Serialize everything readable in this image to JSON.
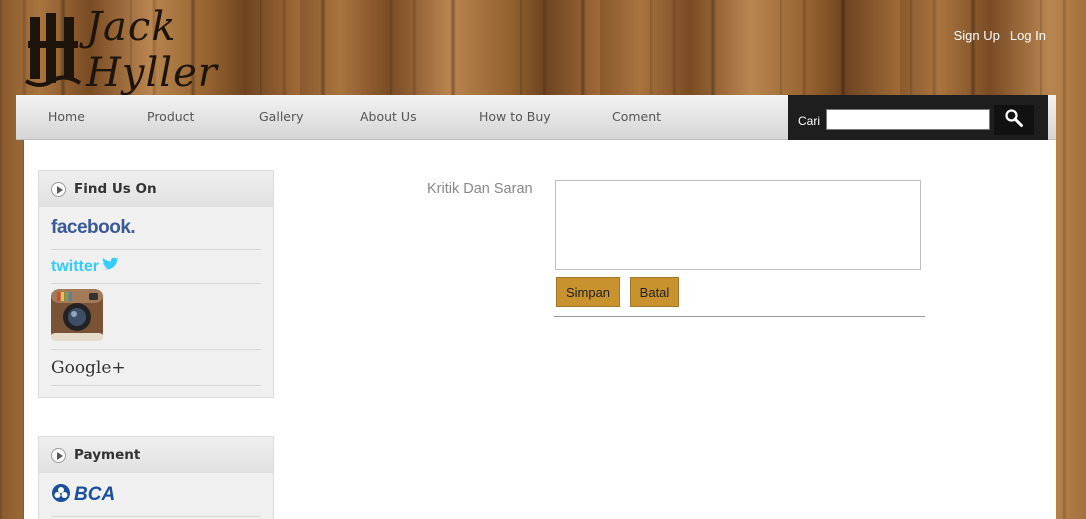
{
  "header": {
    "logo_name": "Jack Hyller",
    "top_links": [
      "Sign Up",
      "Log In"
    ]
  },
  "nav": {
    "items": [
      "Home",
      "Product",
      "Gallery",
      "About Us",
      "How to Buy",
      "Coment"
    ]
  },
  "search": {
    "label": "Cari",
    "value": "",
    "icon": "search-icon"
  },
  "sidebar": {
    "find_us": {
      "title": "Find Us On",
      "items": [
        "facebook.",
        "twitter",
        "Instagram",
        "Google+"
      ]
    },
    "payment": {
      "title": "Payment",
      "items": [
        "BCA"
      ]
    }
  },
  "form": {
    "label": "Kritik Dan Saran",
    "textarea_value": "",
    "save_label": "Simpan",
    "cancel_label": "Batal"
  },
  "colors": {
    "button_bg": "#c8922e",
    "facebook": "#3b5998",
    "twitter": "#33ccff",
    "bca": "#1a4f9c",
    "search_bg": "#1e1e1e"
  }
}
